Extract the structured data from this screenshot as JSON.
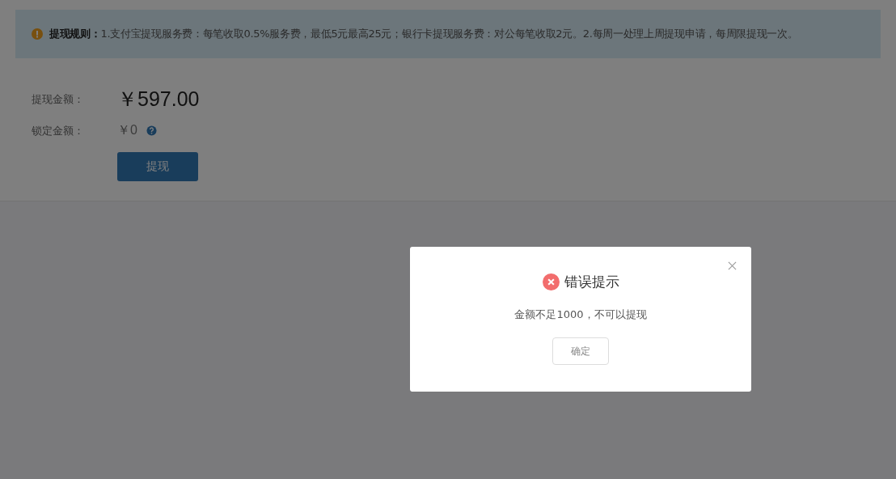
{
  "notice": {
    "text": "**提现规则：**1.支付宝提现服务费：每笔收取0.5%服务费，最低5元最高25元；银行卡提现服务费：对公每笔收取2元。2.每周一处理上周提现申请，每周限提现一次。"
  },
  "fields": [
    {
      "label": "提现金额：",
      "value": "￥597.00",
      "kind": "amount"
    },
    {
      "label": "锁定金额：",
      "value": "￥0",
      "kind": "locked"
    }
  ],
  "withdraw_button": "提现",
  "dialog": {
    "title": "错误提示",
    "message": "金额不足1000，不可以提现",
    "confirm_button": "确定"
  }
}
